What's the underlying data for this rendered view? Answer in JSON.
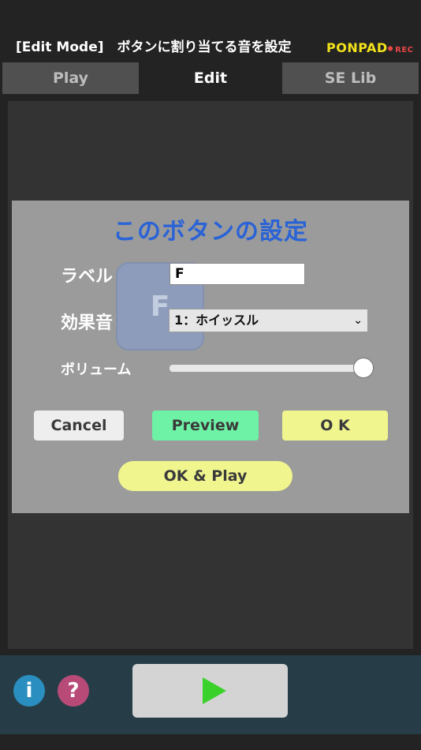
{
  "header": {
    "title": "[Edit Mode]　ボタンに割り当てる音を設定",
    "logo_main": "PONPAD",
    "logo_sub": "REC"
  },
  "tabs": [
    {
      "label": "Play",
      "active": false
    },
    {
      "label": "Edit",
      "active": true
    },
    {
      "label": "SE Lib",
      "active": false
    }
  ],
  "dialog": {
    "title": "このボタンの設定",
    "pad_letter": "F",
    "label_field": {
      "label": "ラベル",
      "value": "F"
    },
    "sound_field": {
      "label": "効果音",
      "selected": "1：ホイッスル"
    },
    "volume": {
      "label": "ボリューム",
      "level": 1.0
    },
    "buttons": {
      "cancel": "Cancel",
      "preview": "Preview",
      "ok": "O K",
      "ok_play": "OK & Play"
    }
  },
  "bottom_bar": {
    "info_icon": "i",
    "help_icon": "?",
    "play_icon": "play-icon"
  },
  "colors": {
    "background": "#232323",
    "dialog_bg": "#9b9b9b",
    "dialog_title": "#2a63d6",
    "preview_button": "#6ef2a6",
    "ok_button": "#f1f58e",
    "info_button": "#2a8fc0",
    "help_button": "#b84a78",
    "play_triangle": "#3ad12a",
    "logo": "#f2e21a"
  }
}
